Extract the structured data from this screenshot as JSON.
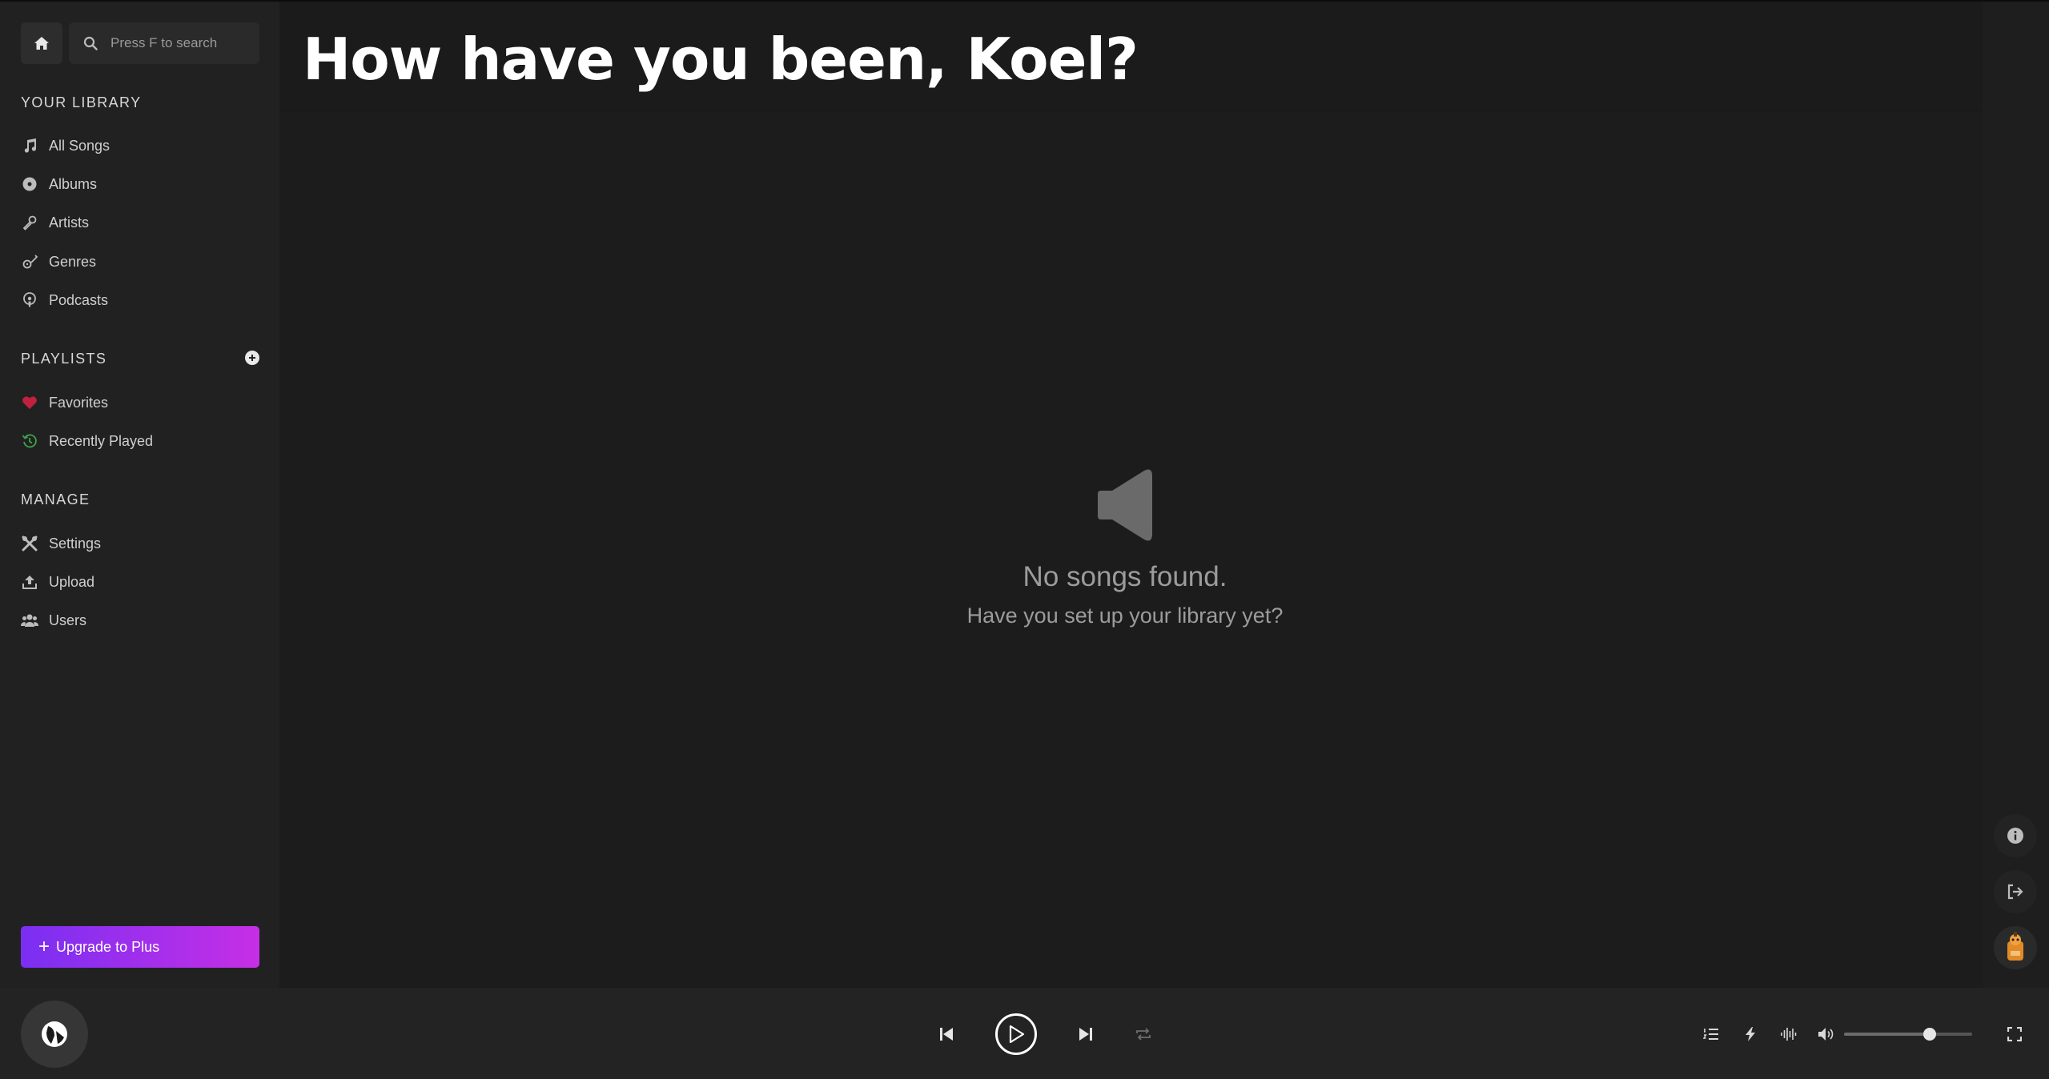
{
  "search": {
    "placeholder": "Press F to search"
  },
  "library": {
    "title": "YOUR LIBRARY",
    "items": [
      {
        "label": "All Songs",
        "icon": "music-note-icon"
      },
      {
        "label": "Albums",
        "icon": "disc-icon"
      },
      {
        "label": "Artists",
        "icon": "microphone-icon"
      },
      {
        "label": "Genres",
        "icon": "guitar-icon"
      },
      {
        "label": "Podcasts",
        "icon": "podcast-icon"
      }
    ]
  },
  "playlists": {
    "title": "PLAYLISTS",
    "items": [
      {
        "label": "Favorites",
        "icon": "heart-icon",
        "color": "#c0213f"
      },
      {
        "label": "Recently Played",
        "icon": "history-icon",
        "color": "#3fa34d"
      }
    ]
  },
  "manage": {
    "title": "MANAGE",
    "items": [
      {
        "label": "Settings",
        "icon": "tools-icon"
      },
      {
        "label": "Upload",
        "icon": "upload-icon"
      },
      {
        "label": "Users",
        "icon": "users-icon"
      }
    ]
  },
  "upgrade": {
    "label": "Upgrade to Plus",
    "gradient_start": "#7a2ff2",
    "gradient_end": "#c62fe6"
  },
  "main": {
    "title": "How have you been, Koel?",
    "empty_title": "No songs found.",
    "empty_subtitle": "Have you set up your library yet?"
  },
  "player": {
    "volume_fraction": 0.67
  }
}
